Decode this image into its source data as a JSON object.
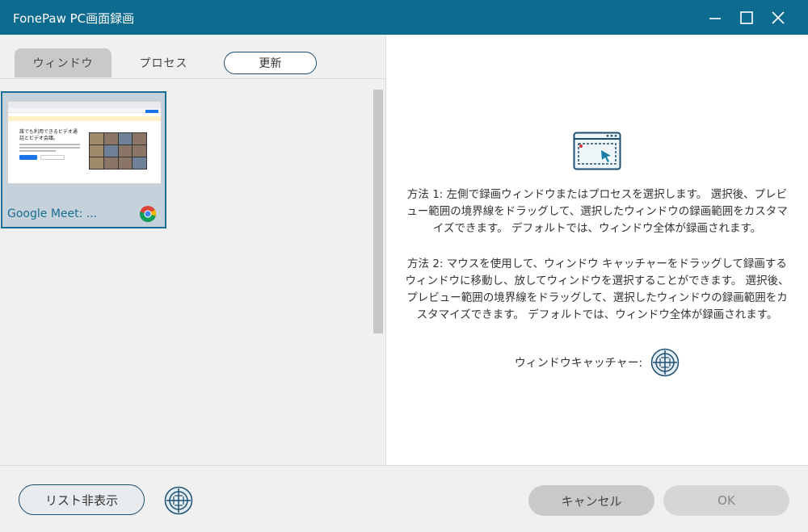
{
  "window": {
    "title": "FonePaw PC画面録画"
  },
  "tabs": {
    "window_tab": "ウィンドウ",
    "process_tab": "プロセス",
    "refresh": "更新"
  },
  "window_list": [
    {
      "label": "Google Meet: ...",
      "icon": "chrome-icon",
      "selected": true,
      "thumb_heading": "誰でも利用できるビデオ通話とビデオ会議。"
    }
  ],
  "instructions": {
    "method1": "方法 1: 左側で録画ウィンドウまたはプロセスを選択します。 選択後、プレビュー範囲の境界線をドラッグして、選択したウィンドウの録画範囲をカスタマイズできます。 デフォルトでは、ウィンドウ全体が録画されます。",
    "method2": "方法 2: マウスを使用して、ウィンドウ キャッチャーをドラッグして録画するウィンドウに移動し、放してウィンドウを選択することができます。 選択後、プレビュー範囲の境界線をドラッグして、選択したウィンドウの録画範囲をカスタマイズできます。 デフォルトでは、ウィンドウ全体が録画されます。",
    "catcher_label": "ウィンドウキャッチャー:"
  },
  "footer": {
    "hide_list": "リスト非表示",
    "cancel": "キャンセル",
    "ok": "OK"
  },
  "colors": {
    "titlebar": "#0d6b8f",
    "accent": "#1a6d92",
    "selected_card": "#c5d2db"
  }
}
